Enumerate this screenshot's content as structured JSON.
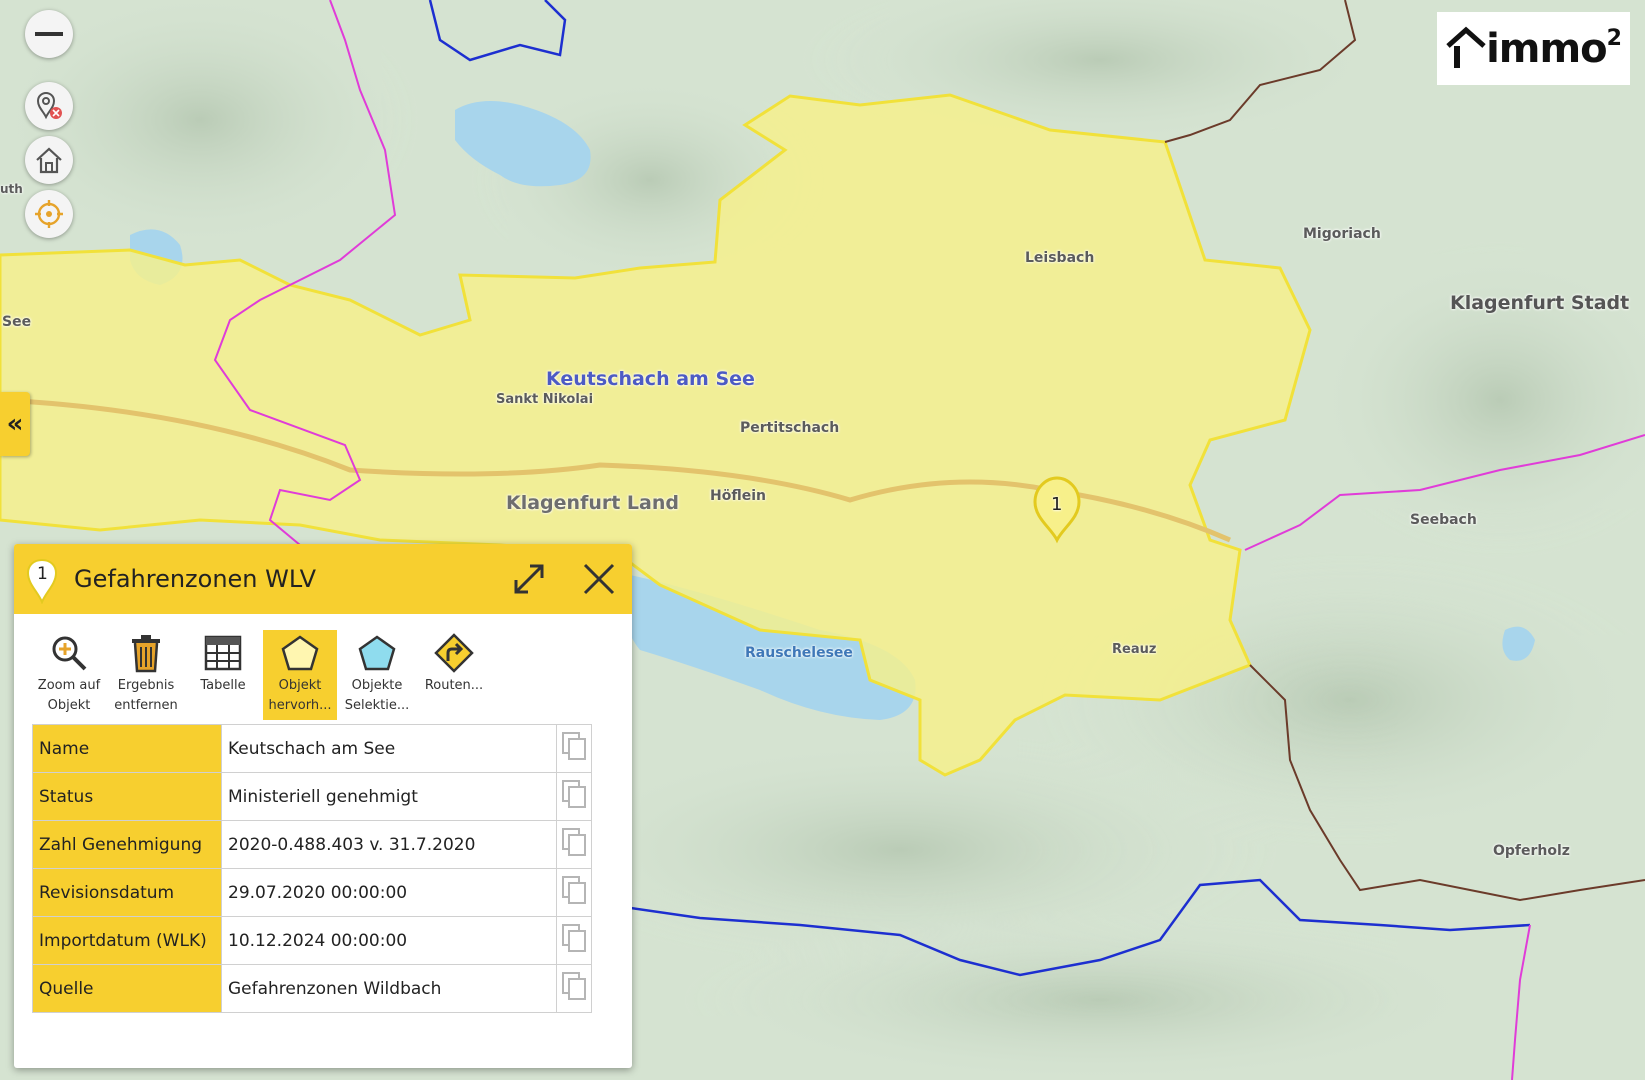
{
  "map": {
    "place_labels": {
      "keutschach": "Keutschach am See",
      "sankt_nikolai": "Sankt Nikolai",
      "pertitschach": "Pertitschach",
      "leisbach": "Leisbach",
      "hoeflein": "Höflein",
      "klagenfurt_land": "Klagenfurt Land",
      "klagenfurt_stadt": "Klagenfurt Stadt",
      "migoriach": "Migoriach",
      "seebach": "Seebach",
      "rauschelesee": "Rauschelesee",
      "reauz": "Reauz",
      "opferholz": "Opferholz",
      "see_left": "See",
      "uth_left": "uth"
    },
    "marker_number": "1",
    "colors": {
      "hazard_zone": "#f7f08a",
      "lake": "#a8d5ec",
      "forest": "#cfdcc9",
      "border_blue": "#1d2fd0",
      "border_magenta": "#e03cd8",
      "border_brown": "#6b3b2a",
      "road": "#e3c36c"
    }
  },
  "controls": {
    "zoom_out": "zoom-out",
    "collapse_label": "«"
  },
  "logo": {
    "text": "immo",
    "superscript": "2"
  },
  "popup": {
    "marker_number": "1",
    "title": "Gefahrenzonen WLV",
    "accent": "#f7cf2f",
    "tools": [
      {
        "line1": "Zoom auf",
        "line2": "Objekt",
        "icon": "zoom-in-icon",
        "active": false
      },
      {
        "line1": "Ergebnis",
        "line2": "entfernen",
        "icon": "trash-icon",
        "active": false
      },
      {
        "line1": "Tabelle",
        "line2": "",
        "icon": "table-icon",
        "active": false
      },
      {
        "line1": "Objekt",
        "line2": "hervorh...",
        "icon": "pentagon-icon",
        "active": true
      },
      {
        "line1": "Objekte",
        "line2": "Selektie...",
        "icon": "select-pentagon-icon",
        "active": false
      },
      {
        "line1": "Routen...",
        "line2": "",
        "icon": "route-icon",
        "active": false
      }
    ],
    "attributes": [
      {
        "key": "Name",
        "value": "Keutschach am See"
      },
      {
        "key": "Status",
        "value": "Ministeriell genehmigt"
      },
      {
        "key": "Zahl Genehmigung",
        "value": "2020-0.488.403 v. 31.7.2020"
      },
      {
        "key": "Revisionsdatum",
        "value": "29.07.2020 00:00:00"
      },
      {
        "key": "Importdatum (WLK)",
        "value": "10.12.2024 00:00:00"
      },
      {
        "key": "Quelle",
        "value": "Gefahrenzonen Wildbach"
      }
    ]
  }
}
